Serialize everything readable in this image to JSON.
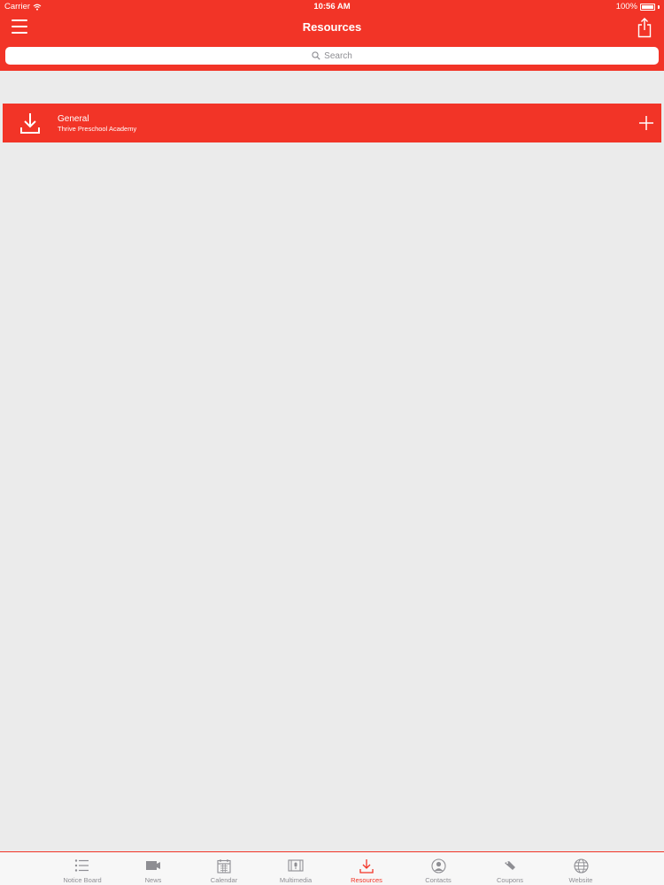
{
  "status_bar": {
    "carrier": "Carrier",
    "time": "10:56 AM",
    "battery": "100%"
  },
  "nav": {
    "title": "Resources"
  },
  "search": {
    "placeholder": "Search"
  },
  "resources": [
    {
      "title": "General",
      "subtitle": "Thrive Preschool Academy"
    }
  ],
  "tabs": [
    {
      "label": "Notice Board",
      "icon": "list-icon"
    },
    {
      "label": "News",
      "icon": "news-icon"
    },
    {
      "label": "Calendar",
      "icon": "calendar-icon"
    },
    {
      "label": "Multimedia",
      "icon": "multimedia-icon"
    },
    {
      "label": "Resources",
      "icon": "download-icon",
      "active": true
    },
    {
      "label": "Contacts",
      "icon": "contact-icon"
    },
    {
      "label": "Coupons",
      "icon": "coupon-icon"
    },
    {
      "label": "Website",
      "icon": "globe-icon"
    }
  ],
  "colors": {
    "accent": "#f23427",
    "background": "#ebebeb",
    "tab_inactive": "#8e8e93"
  }
}
